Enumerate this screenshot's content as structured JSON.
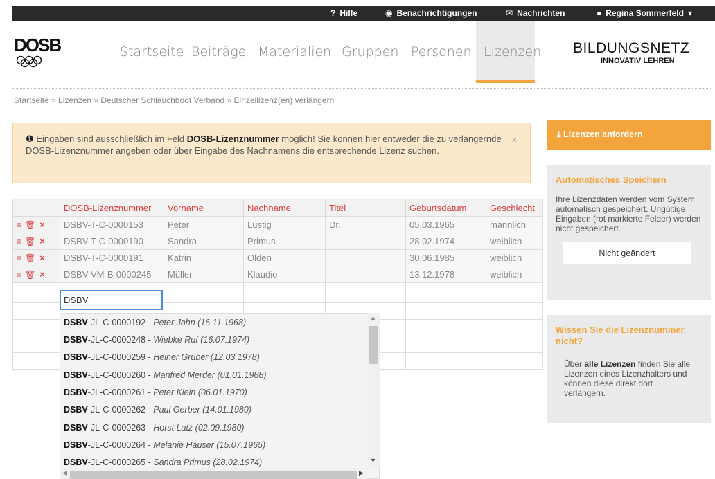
{
  "topbar": {
    "help": "Hilfe",
    "notifications": "Benachrichtigungen",
    "messages": "Nachrichten",
    "user": "Regina Sommerfeld"
  },
  "brand": {
    "logo": "DOSB",
    "title": "BILDUNGSNETZ",
    "subtitle": "INNOVATIV LEHREN"
  },
  "nav": [
    "Startseite",
    "Beiträge",
    "Materialien",
    "Gruppen",
    "Personen",
    "Lizenzen"
  ],
  "breadcrumb": "Startseite » Lizenzen » Deutscher Schlauchboot Verband » Einzellizenz(en) verlängern",
  "alert": {
    "pre": "Eingaben sind ausschließlich im Feld ",
    "bold": "DOSB-Lizenznummer",
    "post": " möglich! Sie können hier entweder die zu verlängernde DOSB-Lizenznummer angeben oder über Eingabe des Nachnamens die entsprechende Lizenz suchen.",
    "close": "×"
  },
  "table": {
    "headers": [
      "DOSB-Lizenznummer",
      "Vorname",
      "Nachname",
      "Titel",
      "Geburtsdatum",
      "Geschlecht"
    ],
    "rows": [
      [
        "DSBV-T-C-0000153",
        "Peter",
        "Lustig",
        "Dr.",
        "05.03.1965",
        "männlich"
      ],
      [
        "DSBV-T-C-0000190",
        "Sandra",
        "Primus",
        "",
        "28.02.1974",
        "weiblich"
      ],
      [
        "DSBV-T-C-0000191",
        "Katrin",
        "Olden",
        "",
        "30.06.1985",
        "weiblich"
      ],
      [
        "DSBV-VM-B-0000245",
        "Müller",
        "Klaudio",
        "",
        "13.12.1978",
        "weiblich"
      ]
    ],
    "input_value": "DSBV"
  },
  "dropdown": {
    "items": [
      {
        "prefix": "DSBV",
        "rest": "-JL-C-0000192 - ",
        "name": "Peter Jahn (16.11.1968)"
      },
      {
        "prefix": "DSBV",
        "rest": "-JL-C-0000248 - ",
        "name": "Wiebke Ruf (16.07.1974)"
      },
      {
        "prefix": "DSBV",
        "rest": "-JL-C-0000259 - ",
        "name": "Heiner Gruber (12.03.1978)"
      },
      {
        "prefix": "DSBV",
        "rest": "-JL-C-0000260 - ",
        "name": "Manfred Merder (01.01.1988)"
      },
      {
        "prefix": "DSBV",
        "rest": "-JL-C-0000261 - ",
        "name": "Peter Klein (06.01.1970)"
      },
      {
        "prefix": "DSBV",
        "rest": "-JL-C-0000262 - ",
        "name": "Paul Gerber (14.01.1980)"
      },
      {
        "prefix": "DSBV",
        "rest": "-JL-C-0000263 - ",
        "name": "Horst Latz (02.09.1980)"
      },
      {
        "prefix": "DSBV",
        "rest": "-JL-C-0000264 - ",
        "name": "Melanie Hauser (15.07.1965)"
      },
      {
        "prefix": "DSBV",
        "rest": "-JL-C-0000265 - ",
        "name": "Sandra Primus (28.02.1974)"
      }
    ]
  },
  "sidebar": {
    "request_button": "Lizenzen anfordern",
    "autosave_title": "Automatisches Speichern",
    "autosave_text": "Ihre Lizenzdaten werden vom System automatisch gespeichert. Ungültige Eingaben (rot markierte Felder) werden nicht gespeichert.",
    "autosave_status": "Nicht geändert",
    "unknown_title": "Wissen Sie die Lizenznummer nicht?",
    "unknown_pre": "Über ",
    "unknown_bold": "alle Lizenzen",
    "unknown_post": " finden Sie alle Lizenzen eines Lizenzhalters und können diese direkt dort verlängern."
  },
  "colors": {
    "accent": "#f3a43c",
    "error": "#d84040",
    "focus": "#4a90d9"
  }
}
